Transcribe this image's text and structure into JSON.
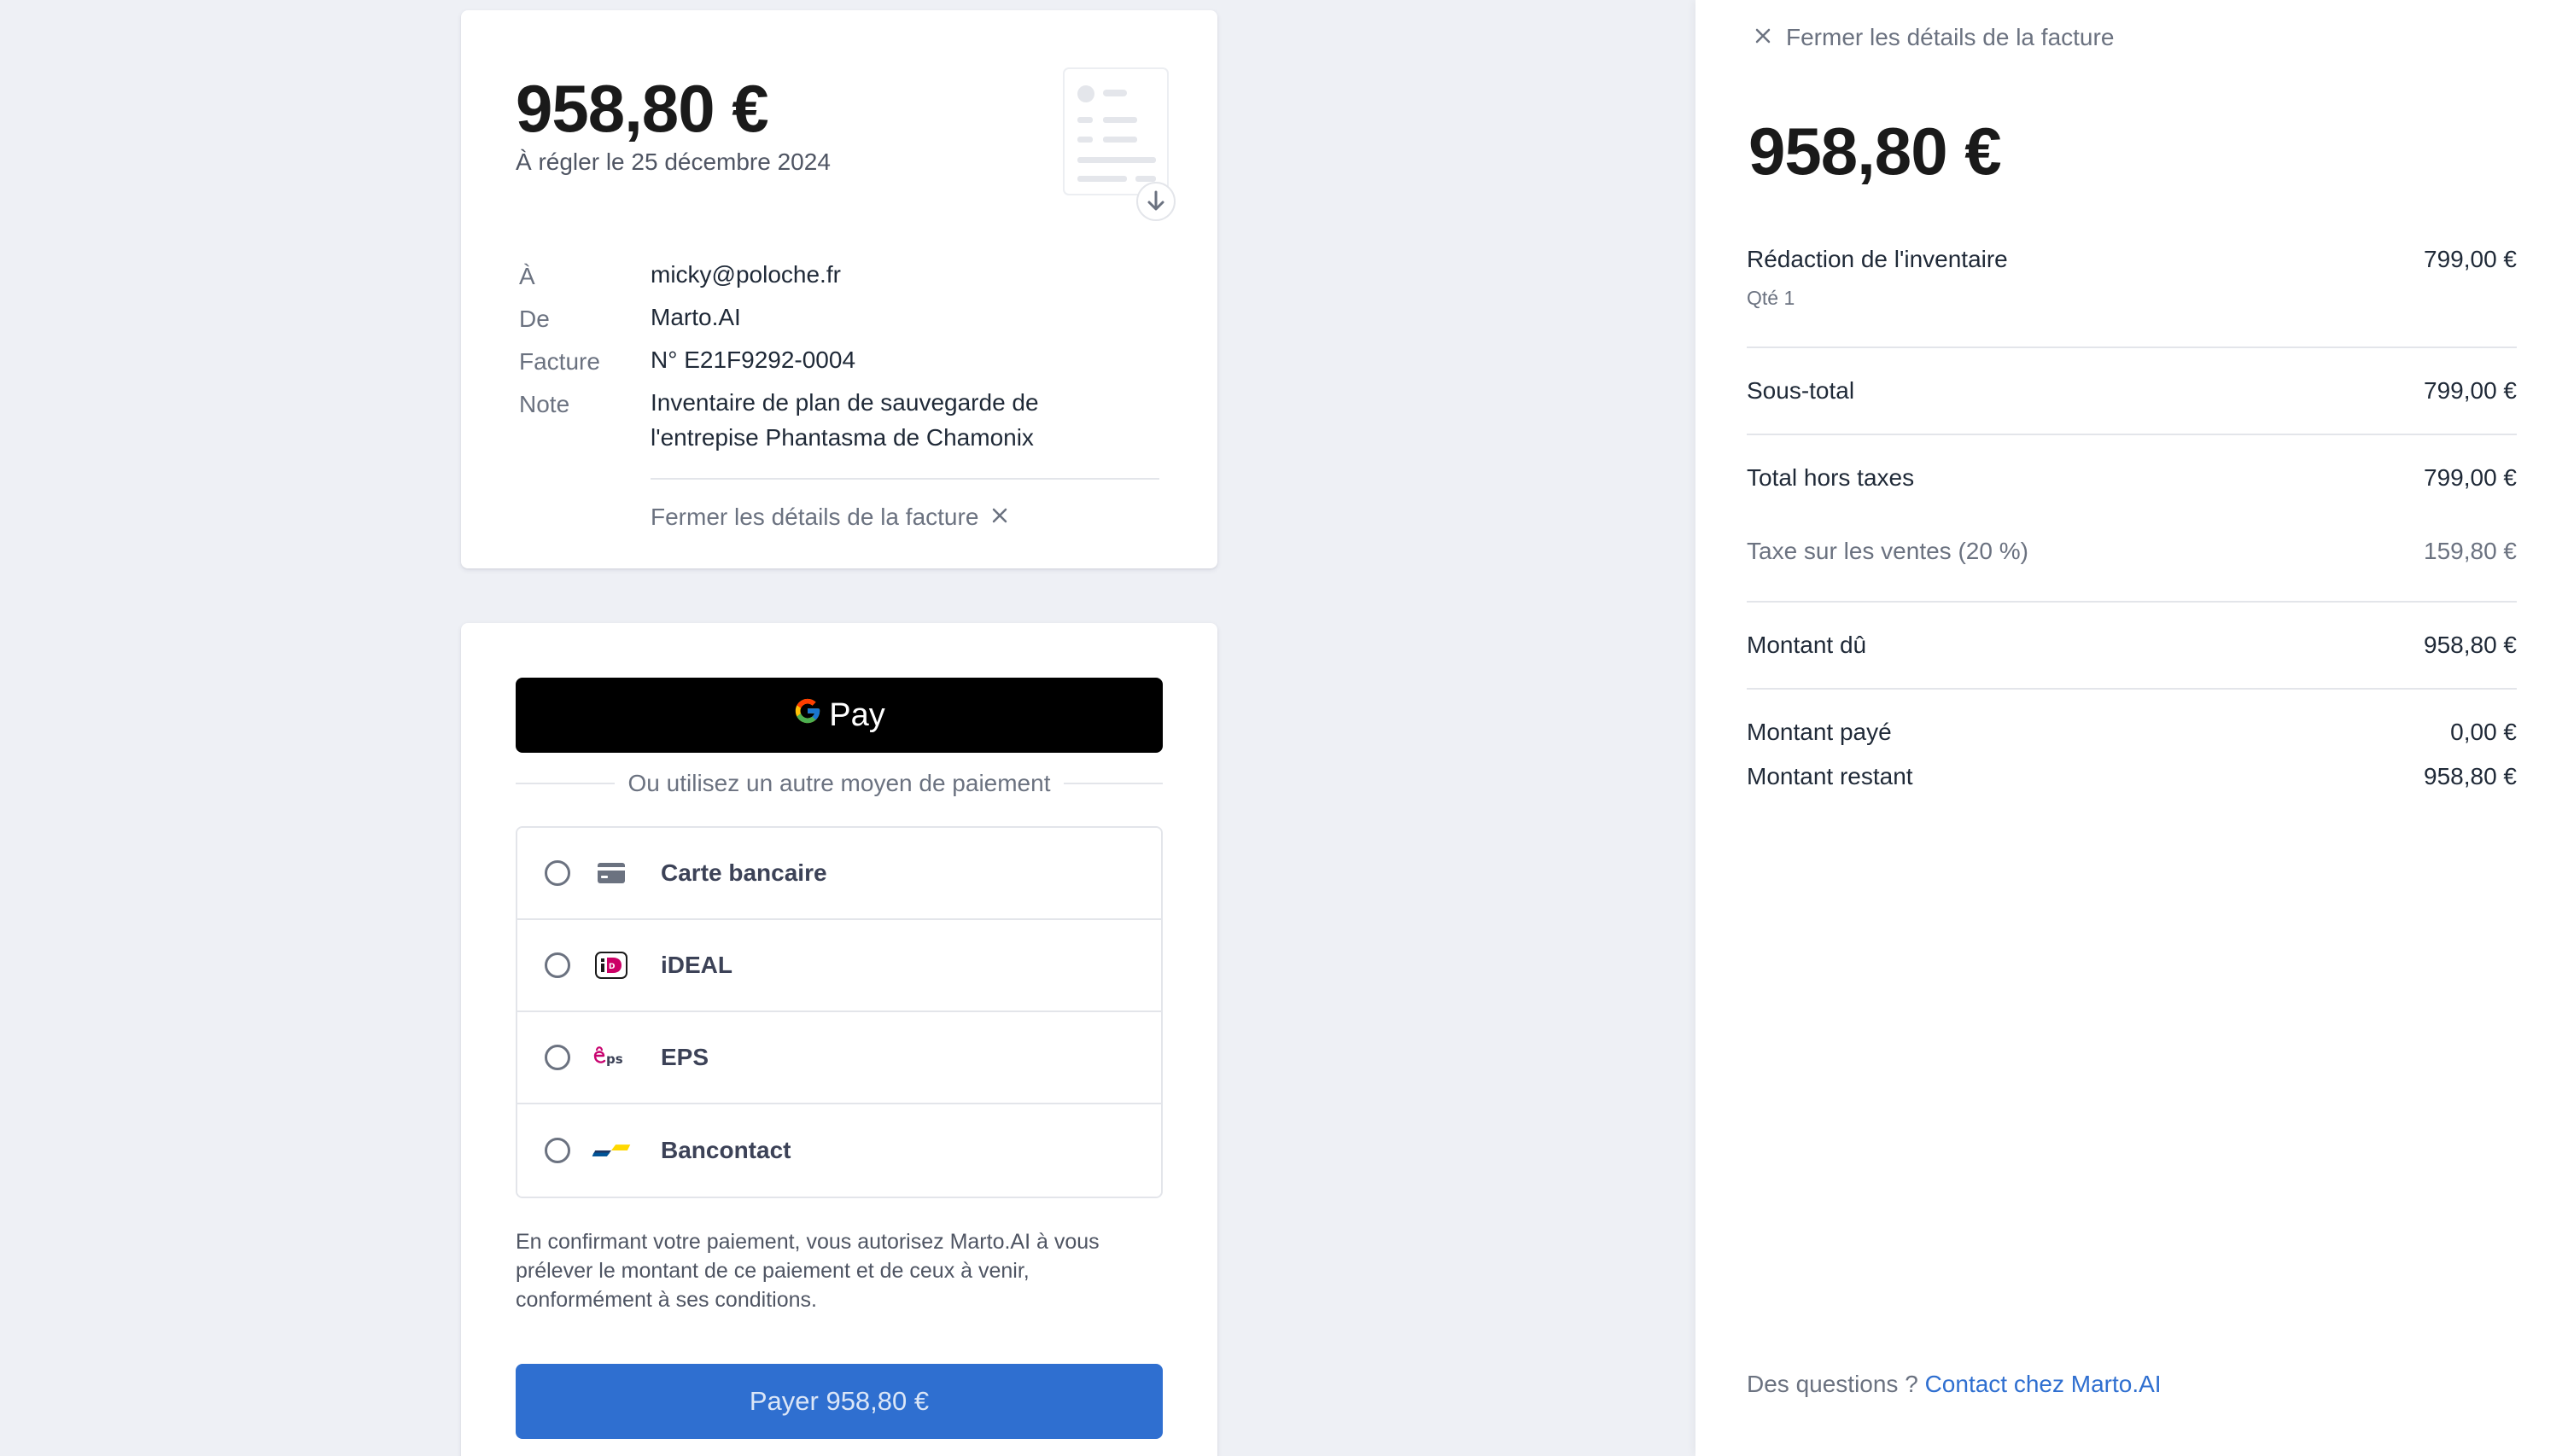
{
  "invoice": {
    "amount": "958,80 €",
    "due_text": "À régler le 25 décembre 2024",
    "meta": {
      "to_label": "À",
      "to_value": "micky@poloche.fr",
      "from_label": "De",
      "from_value": "Marto.AI",
      "invoice_label": "Facture",
      "invoice_value": "N° E21F9292-0004",
      "note_label": "Note",
      "note_line1": "Inventaire de plan de sauvegarde de",
      "note_line2": "l'entrepise Phantasma de Chamonix"
    },
    "close_details_label": "Fermer les détails de la facture"
  },
  "payment": {
    "gpay_label": "Pay",
    "or_label": "Ou utilisez un autre moyen de paiement",
    "methods": [
      {
        "label": "Carte bancaire",
        "icon": "card-icon"
      },
      {
        "label": "iDEAL",
        "icon": "ideal-icon"
      },
      {
        "label": "EPS",
        "icon": "eps-icon"
      },
      {
        "label": "Bancontact",
        "icon": "bancontact-icon"
      }
    ],
    "consent": "En confirmant votre paiement, vous autorisez Marto.AI à vous prélever le montant de ce paiement et de ceux à venir, conformément à ses conditions.",
    "pay_button": "Payer 958,80 €"
  },
  "details": {
    "close_label": "Fermer les détails de la facture",
    "amount": "958,80 €",
    "line_item": {
      "label": "Rédaction de l'inventaire",
      "qty": "Qté 1",
      "value": "799,00 €"
    },
    "subtotal": {
      "label": "Sous-total",
      "value": "799,00 €"
    },
    "total_excl_tax": {
      "label": "Total hors taxes",
      "value": "799,00 €"
    },
    "tax": {
      "label": "Taxe sur les ventes (20 %)",
      "value": "159,80 €"
    },
    "amount_due": {
      "label": "Montant dû",
      "value": "958,80 €"
    },
    "amount_paid": {
      "label": "Montant payé",
      "value": "0,00 €"
    },
    "amount_remaining": {
      "label": "Montant restant",
      "value": "958,80 €"
    },
    "questions_prefix": "Des questions ?",
    "contact_link": "Contact chez Marto.AI"
  },
  "colors": {
    "page_bg": "#eef0f5",
    "pay_button": "#2f6fd0",
    "link": "#2f6fd0"
  }
}
